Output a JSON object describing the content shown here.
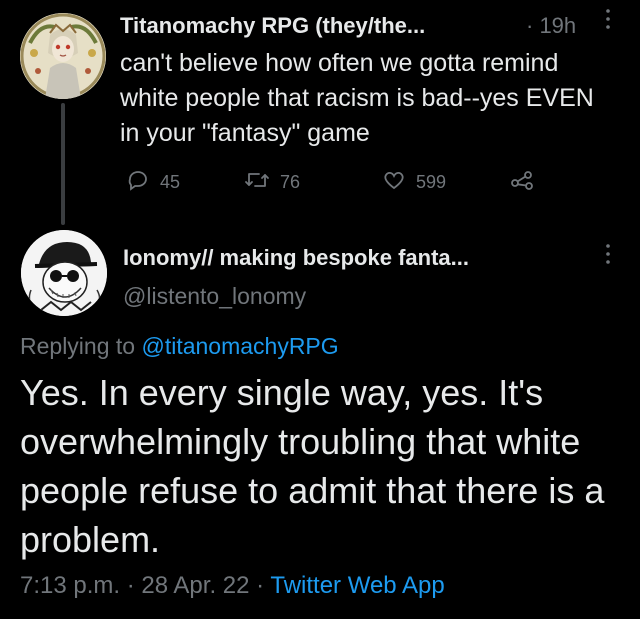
{
  "tweet1": {
    "display_name": "Titanomachy RPG (they/the...",
    "time": "· 19h",
    "text": "can't believe how often we gotta remind white people that racism is bad--yes EVEN in your \"fantasy\" game",
    "replies": "45",
    "retweets": "76",
    "likes": "599"
  },
  "tweet2": {
    "display_name": "Ionomy// making bespoke fanta...",
    "handle": "@listento_lonomy",
    "replying_prefix": "Replying to ",
    "replying_to": "@titanomachyRPG",
    "text": "Yes. In every single way, yes. It's overwhelmingly troubling that white people refuse to admit that there is a problem.",
    "meta_time": "7:13 p.m. · 28 Apr. 22 · ",
    "meta_app": "Twitter Web App"
  },
  "icons": {
    "reply": "speech-bubble-icon",
    "retweet": "retweet-arrows-icon",
    "like": "heart-icon",
    "share": "share-icon",
    "more": "vertical-ellipsis-icon"
  },
  "colors": {
    "background": "#000000",
    "text": "#e7e9ea",
    "secondary": "#71767b",
    "link": "#1d9bf0"
  }
}
